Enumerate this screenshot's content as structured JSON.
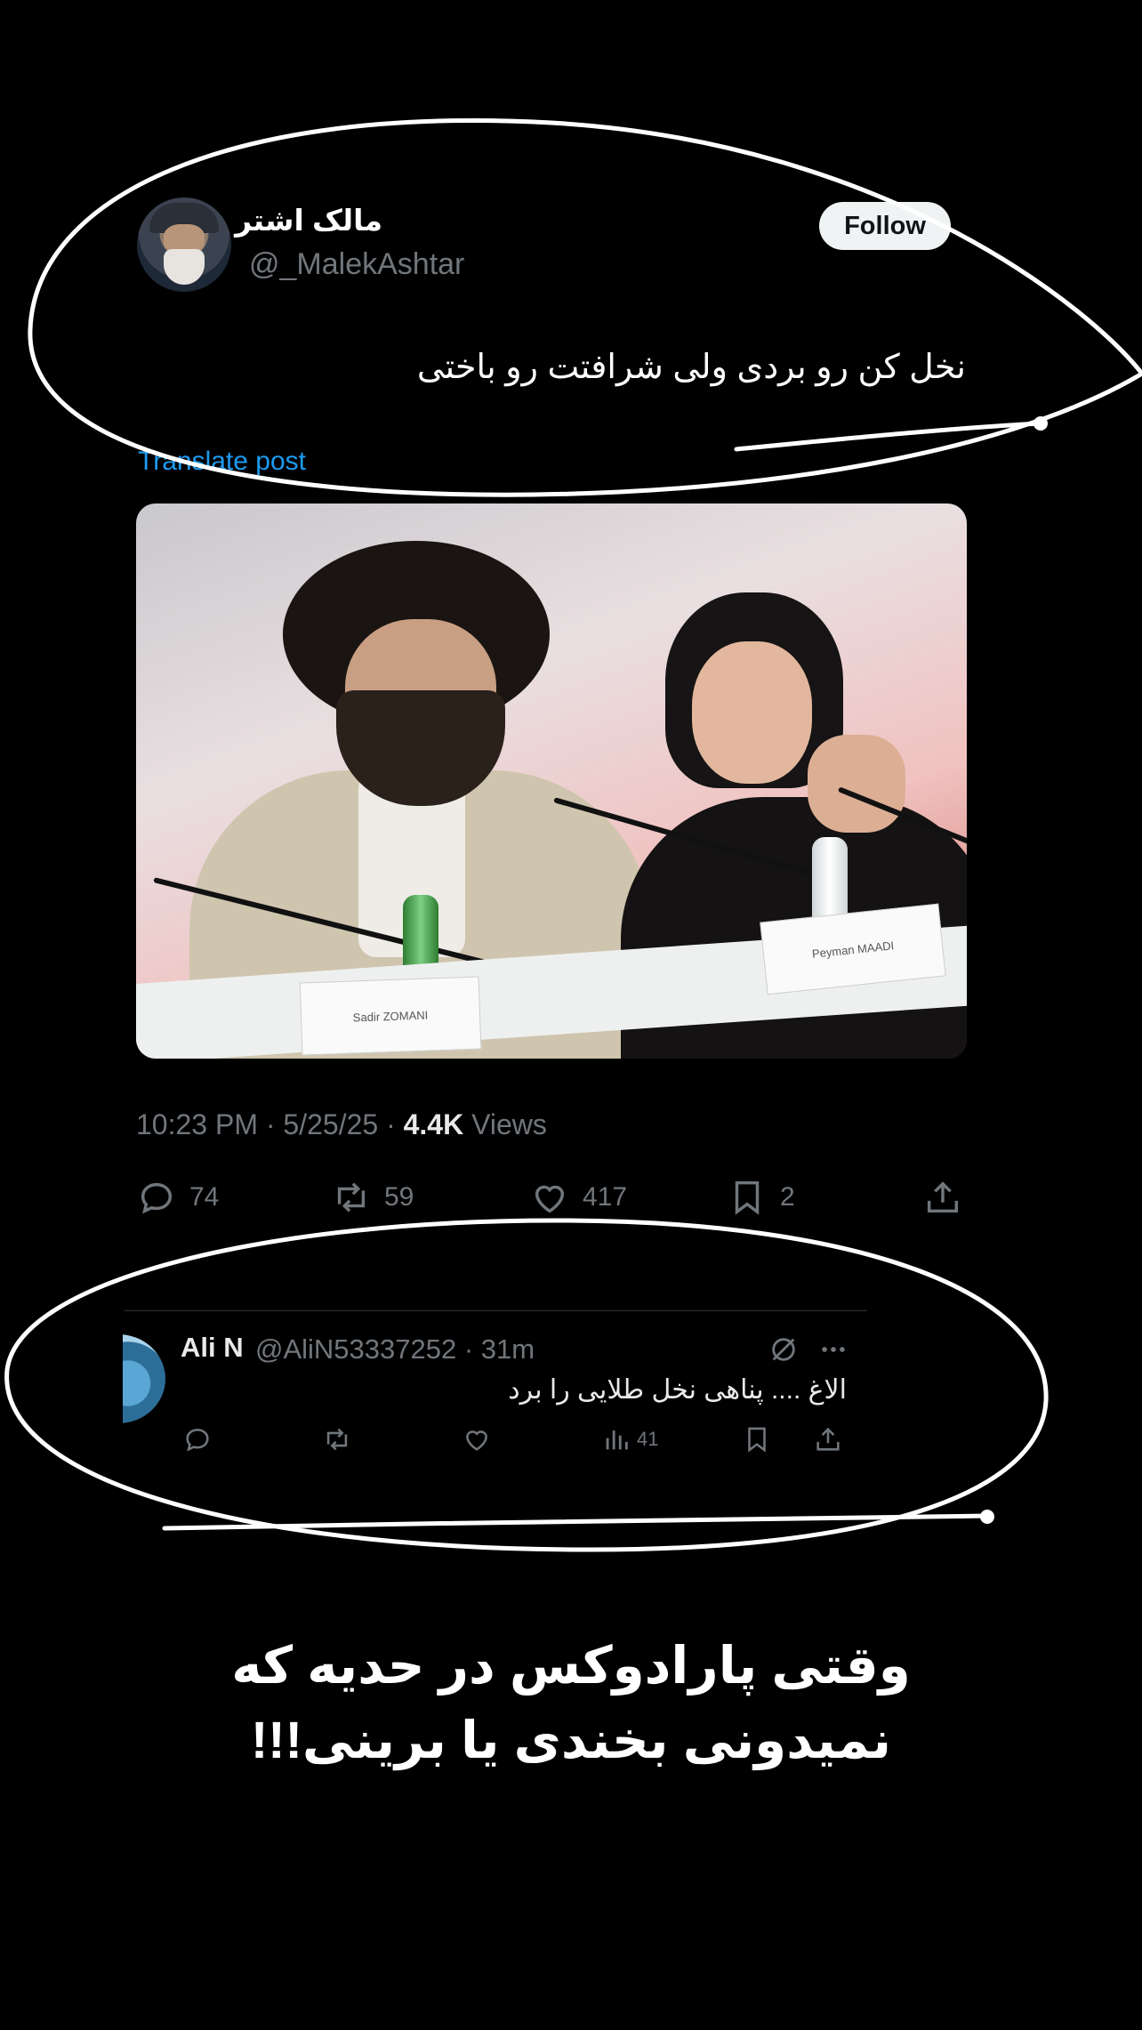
{
  "tweet": {
    "display_name": "مالک اشتر",
    "handle": "@_MalekAshtar",
    "follow_label": "Follow",
    "text": "نخل کن رو بردی ولی شرافتت رو باختی",
    "translate_label": "Translate post",
    "time": "10:23 PM",
    "date": "5/25/25",
    "views_count": "4.4K",
    "views_label": "Views",
    "photo": {
      "nameplate_left": "Sadir ZOMANI",
      "nameplate_right": "Peyman MAADI"
    },
    "actions": {
      "replies": "74",
      "reposts": "59",
      "likes": "417",
      "bookmarks": "2"
    }
  },
  "reply": {
    "name": "Ali N",
    "handle_meta": "@AliN53337252 · 31m",
    "text": "الاغ .... پناهی نخل طلایی را برد",
    "views": "41"
  },
  "caption": {
    "line1": "وقتی  پارادوکس در حدیه که",
    "line2": "نمیدونی بخندی یا برینی!!!"
  },
  "colors": {
    "background": "#000000",
    "accent_link": "#1d9bf0",
    "muted_text": "#71767b",
    "annotation": "#ffffff"
  }
}
